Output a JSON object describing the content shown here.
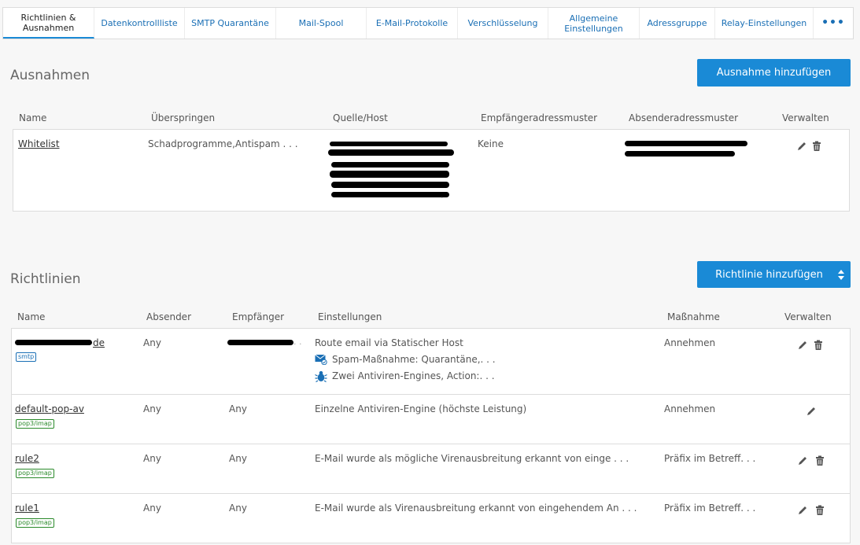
{
  "tabs": [
    {
      "label": "Richtlinien &\nAusnahmen",
      "active": true
    },
    {
      "label": "Datenkontrollliste"
    },
    {
      "label": "SMTP Quarantäne"
    },
    {
      "label": "Mail-Spool"
    },
    {
      "label": "E-Mail-Protokolle"
    },
    {
      "label": "Verschlüsselung"
    },
    {
      "label": "Allgemeine\nEinstellungen"
    },
    {
      "label": "Adressgruppe"
    },
    {
      "label": "Relay-Einstellungen"
    },
    {
      "label": "•••"
    }
  ],
  "exceptions": {
    "title": "Ausnahmen",
    "add_button": "Ausnahme hinzufügen",
    "headers": {
      "name": "Name",
      "skip": "Überspringen",
      "source": "Quelle/Host",
      "recipient": "Empfängeradressmuster",
      "sender": "Absenderadressmuster",
      "manage": "Verwalten"
    },
    "rows": [
      {
        "name": "Whitelist",
        "skip": "Schadprogramme,Antispam . . .",
        "recipient": "Keine"
      }
    ]
  },
  "policies": {
    "title": "Richtlinien",
    "add_button": "Richtlinie hinzufügen",
    "headers": {
      "name": "Name",
      "sender": "Absender",
      "recipient": "Empfänger",
      "settings": "Einstellungen",
      "action": "Maßnahme",
      "manage": "Verwalten"
    },
    "rows": [
      {
        "name": "de",
        "tag": "smtp",
        "sender": "Any",
        "recipient": "",
        "settings": "Route email via Statischer Host",
        "sub1": "Spam-Maßnahme: Quarantäne,. . .",
        "sub2": "Zwei Antiviren-Engines, Action:. . .",
        "action": "Annehmen"
      },
      {
        "name": "default-pop-av",
        "tag": "pop3/imap",
        "sender": "Any",
        "recipient": "Any",
        "settings": "Einzelne Antiviren-Engine (höchste Leistung)",
        "action": "Annehmen"
      },
      {
        "name": "rule2",
        "tag": "pop3/imap",
        "sender": "Any",
        "recipient": "Any",
        "settings": "E-Mail wurde als mögliche Virenausbreitung erkannt von einge . . .",
        "action": "Präfix im Betreff. . ."
      },
      {
        "name": "rule1",
        "tag": "pop3/imap",
        "sender": "Any",
        "recipient": "Any",
        "settings": "E-Mail wurde als Virenausbreitung erkannt von eingehendem An . . .",
        "action": "Präfix im Betreff. . ."
      }
    ]
  },
  "colors": {
    "accent": "#1a8ad6",
    "link": "#1a6fb5",
    "pop_tag": "#2a8a2a"
  }
}
